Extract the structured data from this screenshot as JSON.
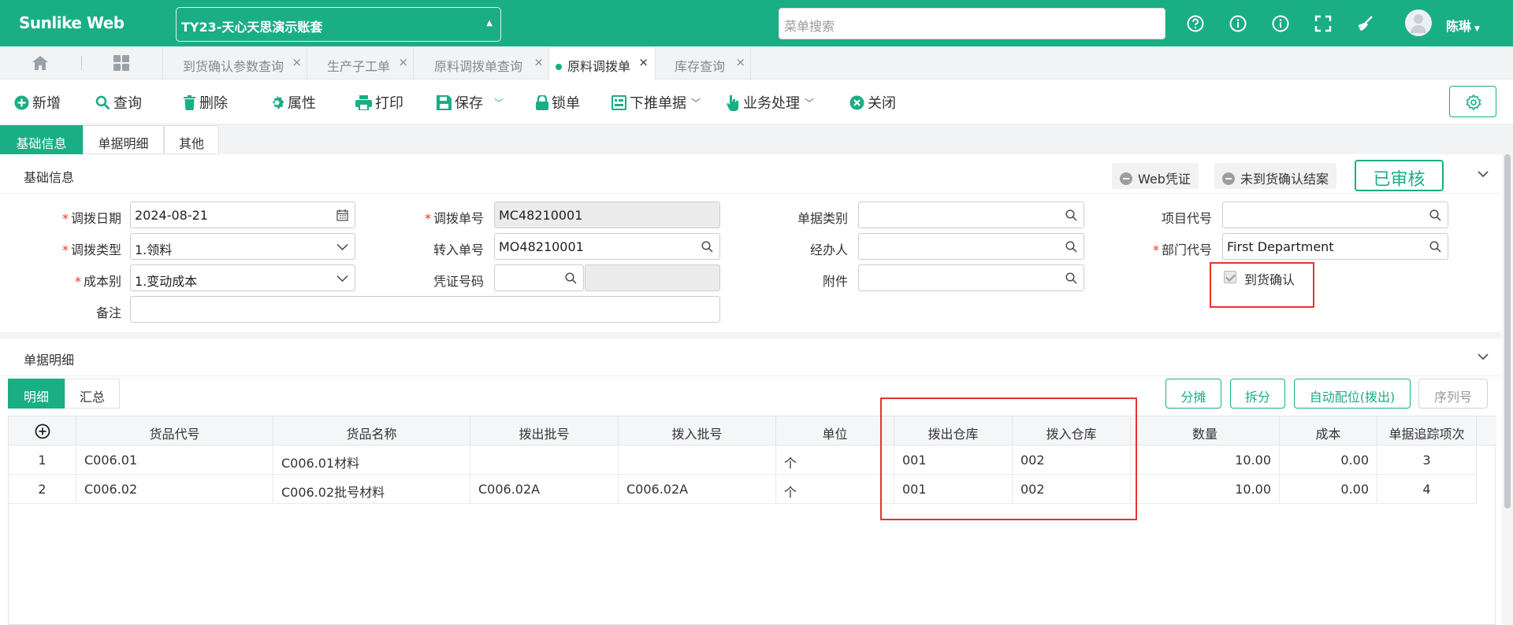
{
  "header": {
    "brand": "Sunlike Web",
    "account_name": "TY23-天心天思演示账套",
    "search_placeholder": "菜单搜索",
    "user_name": "陈琳",
    "icons": [
      "help-icon",
      "info-icon",
      "about-icon",
      "fullscreen-icon",
      "clean-icon"
    ]
  },
  "tabs": [
    {
      "label": "到货确认参数查询",
      "active": false
    },
    {
      "label": "生产子工单",
      "active": false
    },
    {
      "label": "原料调拨单查询",
      "active": false
    },
    {
      "label": "原料调拨单",
      "active": true
    },
    {
      "label": "库存查询",
      "active": false
    }
  ],
  "toolbar": {
    "add": "新增",
    "query": "查询",
    "delete": "删除",
    "property": "属性",
    "print": "打印",
    "save": "保存",
    "lock": "锁单",
    "push": "下推单据",
    "business": "业务处理",
    "close": "关闭"
  },
  "section_tabs": [
    "基础信息",
    "单据明细",
    "其他"
  ],
  "basic": {
    "title": "基础信息",
    "web_voucher": "Web凭证",
    "unconfirmed_close": "未到货确认结案",
    "status": "已审核"
  },
  "form": {
    "transfer_date_label": "调拨日期",
    "transfer_date": "2024-08-21",
    "transfer_no_label": "调拨单号",
    "transfer_no": "MC48210001",
    "doc_category_label": "单据类别",
    "doc_category": "",
    "project_code_label": "项目代号",
    "project_code": "",
    "transfer_type_label": "调拨类型",
    "transfer_type": "1.领料",
    "source_no_label": "转入单号",
    "source_no": "MO48210001",
    "handler_label": "经办人",
    "handler": "",
    "dept_code_label": "部门代号",
    "dept_code": "First Department",
    "cost_label": "成本别",
    "cost": "1.变动成本",
    "voucher_no_label": "凭证号码",
    "voucher_no": "",
    "attachment_label": "附件",
    "attachment": "",
    "arrival_confirm_label": "到货确认",
    "arrival_confirm_checked": true,
    "remark_label": "备注",
    "remark": ""
  },
  "detail": {
    "title": "单据明细",
    "subtabs": [
      "明细",
      "汇总"
    ],
    "buttons": {
      "allocate": "分摊",
      "split": "拆分",
      "auto_slot": "自动配位(拨出)",
      "serial": "序列号"
    },
    "columns": [
      "货品代号",
      "货品名称",
      "拨出批号",
      "拨入批号",
      "单位",
      "拨出仓库",
      "拨入仓库",
      "数量",
      "成本",
      "单据追踪项次"
    ],
    "rows": [
      {
        "idx": "1",
        "code": "C006.01",
        "name": "C006.01材料",
        "out_lot": "",
        "in_lot": "",
        "unit": "个",
        "out_wh": "001",
        "in_wh": "002",
        "qty": "10.00",
        "cost": "0.00",
        "trace": "3"
      },
      {
        "idx": "2",
        "code": "C006.02",
        "name": "C006.02批号材料",
        "out_lot": "C006.02A",
        "in_lot": "C006.02A",
        "unit": "个",
        "out_wh": "001",
        "in_wh": "002",
        "qty": "10.00",
        "cost": "0.00",
        "trace": "4"
      }
    ]
  },
  "colors": {
    "primary": "#1aae84",
    "highlight": "#e8322f"
  }
}
